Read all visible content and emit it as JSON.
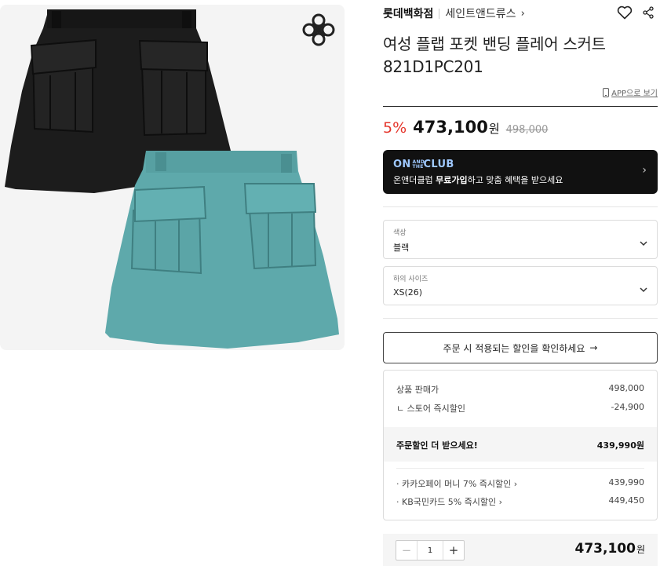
{
  "product": {
    "brand": "롯데백화점",
    "sub_brand": "세인트앤드류스",
    "title_line1": "여성 플랩 포켓 밴딩 플레어 스커트",
    "title_line2": "821D1PC201",
    "app_link": "APP으로 보기"
  },
  "price": {
    "discount_rate": "5%",
    "sale_price": "473,100",
    "currency": "원",
    "original_price": "498,000"
  },
  "club_banner": {
    "logo_left": "ON",
    "logo_and": "AND THE",
    "logo_right": "CLUB",
    "text_pre": "온앤더클럽 ",
    "text_bold": "무료가입",
    "text_post": "하고 맞춤 혜택을 받으세요"
  },
  "options": [
    {
      "label": "색상",
      "value": "블랙"
    },
    {
      "label": "하의 사이즈",
      "value": "XS(26)"
    }
  ],
  "discount_check_button": "주문 시 적용되는 할인을 확인하세요",
  "price_breakdown": {
    "rows": [
      {
        "label": "상품 판매가",
        "value": "498,000"
      },
      {
        "label": "ㄴ  스토어 즉시할인",
        "value": "-24,900"
      }
    ],
    "highlight": {
      "label": "주문할인 더 받으세요!",
      "value": "439,990원"
    },
    "card_rows": [
      {
        "label": "· 카카오페이 머니 7% 즉시할인",
        "value": "439,990"
      },
      {
        "label": "· KB국민카드 5% 즉시할인",
        "value": "449,450"
      }
    ]
  },
  "quantity": {
    "minus": "−",
    "value": "1",
    "plus": "+"
  },
  "total": {
    "amount": "473,100",
    "currency": "원"
  },
  "icons": {
    "brand_logo": "flower-logo-icon",
    "heart": "heart-icon",
    "share": "share-icon",
    "phone": "phone-icon",
    "chevron": "chevron-down-icon"
  },
  "colors": {
    "discount_red": "#e5352b",
    "banner_bg": "#111111",
    "club_blue": "#9fc9ff",
    "skirt_black": "#1b1b1b",
    "skirt_teal": "#5ba6a8"
  }
}
